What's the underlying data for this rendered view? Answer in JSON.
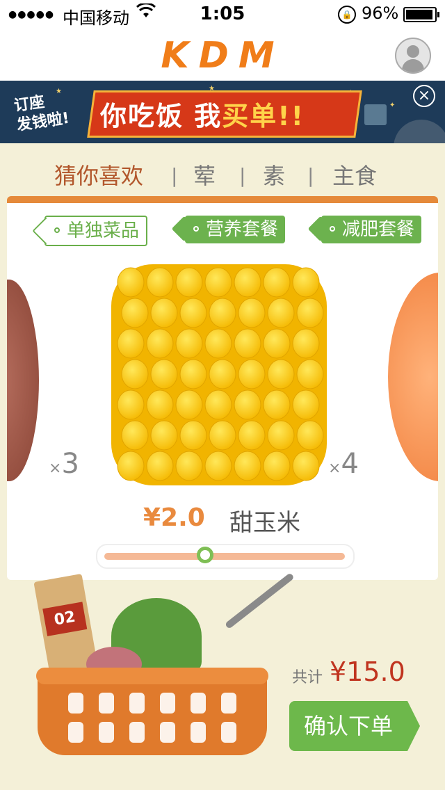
{
  "status_bar": {
    "signal": "●●●●●",
    "carrier": "中国移动",
    "wifi_icon": "wifi-icon",
    "time": "1:05",
    "rotation_lock_icon": "rotation-lock-icon",
    "battery_percent": "96%"
  },
  "header": {
    "logo_text": "KDM",
    "avatar_icon": "user-avatar-icon"
  },
  "banner": {
    "small_text_line1": "订座",
    "small_text_line2": "发钱啦!",
    "headline_part1": "你吃饭 我",
    "headline_part2": "买单!!",
    "close_icon": "close-icon",
    "close_symbol": "×"
  },
  "category_tabs": [
    {
      "label": "猜你喜欢",
      "active": true
    },
    {
      "label": "荤",
      "active": false
    },
    {
      "label": "素",
      "active": false
    },
    {
      "label": "主食",
      "active": false
    }
  ],
  "category_separator": "|",
  "filter_tags": [
    {
      "label": "单独菜品",
      "selected": true
    },
    {
      "label": "营养套餐",
      "selected": false
    },
    {
      "label": "减肥套餐",
      "selected": false
    }
  ],
  "carousel": {
    "left_item_qty_prefix": "×",
    "left_item_qty": "3",
    "right_item_qty_prefix": "×",
    "right_item_qty": "4",
    "current_item": {
      "price": "¥2.0",
      "name": "甜玉米"
    },
    "slider_position": 0.42
  },
  "cart": {
    "tag_number": "02",
    "total_label": "共计",
    "total_value": "¥15.0",
    "confirm_label": "确认下单"
  },
  "colors": {
    "brand_orange": "#f07d19",
    "accent_green": "#6cb24e",
    "price_orange": "#e98a3e",
    "total_red": "#c0341f",
    "background": "#f4f0d8"
  }
}
